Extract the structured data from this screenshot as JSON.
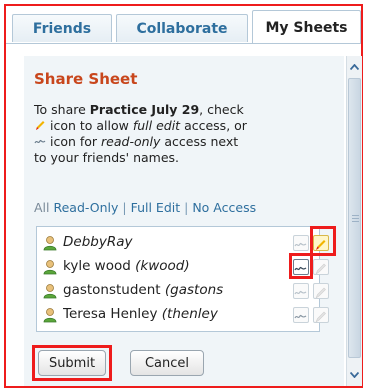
{
  "tabs": [
    {
      "label": "Friends"
    },
    {
      "label": "Collaborate"
    },
    {
      "label": "My Sheets",
      "active": true
    }
  ],
  "panel": {
    "title": "Share Sheet",
    "desc_prefix": "To share ",
    "sheet_name": "Practice July 29",
    "desc_after_name": ", check",
    "desc_pen": " icon to allow ",
    "full_edit_em": "full edit",
    "desc_access_or": " access, or",
    "desc_icon_for": " icon for ",
    "read_only_em": "read-only",
    "desc_access_next": " access next",
    "desc_last": "to your friends' names."
  },
  "filters": {
    "all": "All",
    "read_only": "Read-Only",
    "full_edit": "Full Edit",
    "no_access": "No Access",
    "sep": "|"
  },
  "friends": [
    {
      "name": "DebbyRay",
      "username": "",
      "italic_name": true,
      "read_only": false,
      "full_edit": true
    },
    {
      "name": "kyle wood",
      "username": "(kwood)",
      "italic_name": false,
      "read_only": true,
      "full_edit": false
    },
    {
      "name": "gastonstudent",
      "username": "(gastons",
      "italic_name": false,
      "read_only": false,
      "full_edit": false
    },
    {
      "name": "Teresa Henley",
      "username": "(thenley",
      "italic_name": false,
      "read_only": false,
      "full_edit": false
    }
  ],
  "buttons": {
    "submit": "Submit",
    "cancel": "Cancel"
  },
  "colors": {
    "highlight": "#ee1c1c",
    "accent_title": "#c8461c",
    "link": "#2e6f9e"
  }
}
